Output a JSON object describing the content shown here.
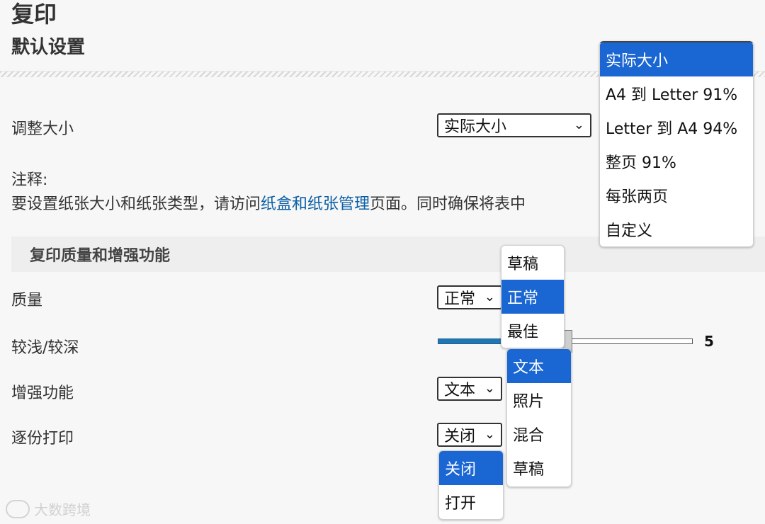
{
  "header": {
    "title": "复印",
    "subtitle": "默认设置"
  },
  "resize": {
    "label": "调整大小",
    "selected": "实际大小",
    "options": [
      "实际大小",
      "A4 到 Letter 91%",
      "Letter 到 A4 94%",
      "整页 91%",
      "每张两页",
      "自定义"
    ]
  },
  "notes": {
    "heading": "注释:",
    "text_before": "要设置纸张大小和纸张类型，请访问",
    "link": "纸盒和纸张管理",
    "text_after": "页面。同时确保将表中"
  },
  "section": {
    "title": "复印质量和增强功能"
  },
  "quality": {
    "label": "质量",
    "selected": "正常",
    "options": [
      "草稿",
      "正常",
      "最佳"
    ]
  },
  "darkness": {
    "label": "较浅/较深",
    "value": "5"
  },
  "enhancement": {
    "label": "增强功能",
    "selected": "文本",
    "options": [
      "文本",
      "照片",
      "混合",
      "草稿"
    ]
  },
  "collate": {
    "label": "逐份打印",
    "selected": "关闭",
    "options": [
      "关闭",
      "打开"
    ]
  },
  "watermark": {
    "text": "大数跨境"
  },
  "colors": {
    "accent": "#1a66d2",
    "link": "#0b5fa5",
    "slider": "#1f78b4"
  },
  "icons": {
    "chevron": "chevron-down-icon"
  }
}
